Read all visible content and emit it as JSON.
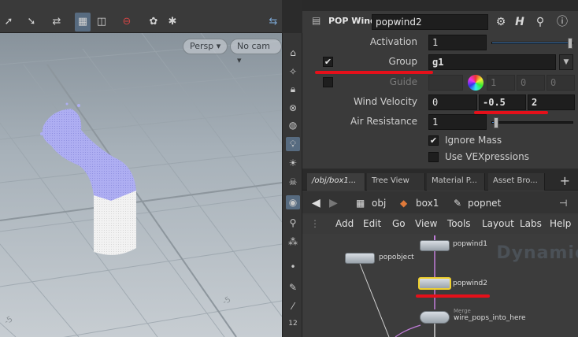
{
  "viewport": {
    "persp_label": "Persp ▾",
    "cam_label": "No cam ▾",
    "side_number": "12"
  },
  "params": {
    "node_type": "POP Wind",
    "node_name": "popwind2",
    "rows": {
      "activation_label": "Activation",
      "activation_value": "1",
      "group_label": "Group",
      "group_value": "g1",
      "guide_label": "Guide",
      "guide_values": [
        "1",
        "0",
        "0"
      ],
      "wind_velocity_label": "Wind Velocity",
      "wind_velocity": [
        "0",
        "-0.5",
        "2"
      ],
      "air_resistance_label": "Air Resistance",
      "air_resistance_value": "1",
      "ignore_mass_label": "Ignore Mass",
      "use_vex_label": "Use VEXpressions"
    },
    "sliders": {
      "activation": 1.0,
      "air_resistance": 0.05
    }
  },
  "network": {
    "tabs": [
      "/obj/box1...",
      "Tree View",
      "Material P...",
      "Asset Bro..."
    ],
    "path": [
      "obj",
      "box1",
      "popnet"
    ],
    "menu": [
      "Add",
      "Edit",
      "Go",
      "View",
      "Tools",
      "Layout",
      "Labs",
      "Help"
    ],
    "watermark": "Dynamic",
    "nodes": {
      "popwind1": "popwind1",
      "popobject": "popobject",
      "popwind2": "popwind2",
      "merge_sub": "Merge",
      "merge": "wire_pops_into_here"
    }
  },
  "colors": {
    "accent_red": "#e5101a",
    "selected_node": "#f0d12e",
    "particle_top": "#a9a9f0",
    "particle_base": "#f4f4f4"
  }
}
